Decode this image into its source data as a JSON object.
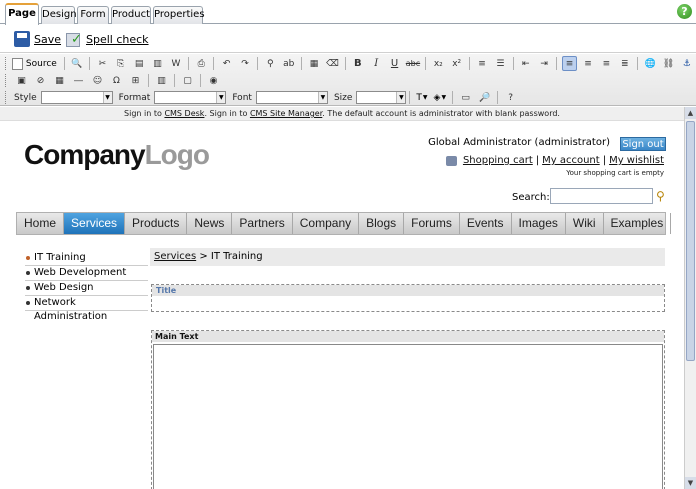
{
  "tabs": [
    "Page",
    "Design",
    "Form",
    "Product",
    "Properties"
  ],
  "actions": {
    "save": "Save",
    "spell_check": "Spell check"
  },
  "toolbar": {
    "source": "Source",
    "style_label": "Style",
    "format_label": "Format",
    "font_label": "Font",
    "size_label": "Size"
  },
  "signin_strip": {
    "prefix": "Sign in to ",
    "desk": "CMS Desk",
    "mid": ". Sign in to ",
    "manager": "CMS Site Manager",
    "suffix": ". The default account is administrator with blank password."
  },
  "header": {
    "logo_main": "Company",
    "logo_accent": "Logo",
    "user": "Global Administrator (administrator)",
    "sign_out": "Sign out",
    "shopping_cart": "Shopping cart",
    "my_account": "My account",
    "my_wishlist": "My wishlist",
    "cart_note": "Your shopping cart is empty",
    "search_label": "Search:"
  },
  "menu": [
    "Home",
    "Services",
    "Products",
    "News",
    "Partners",
    "Company",
    "Blogs",
    "Forums",
    "Events",
    "Images",
    "Wiki",
    "Examples"
  ],
  "menu_active": "Services",
  "leftnav": [
    "IT Training",
    "Web Development",
    "Web Design",
    "Network Administration"
  ],
  "breadcrumb": {
    "parent": "Services",
    "sep": " > ",
    "current": "IT Training"
  },
  "zones": {
    "title": "Title",
    "main_text": "Main Text"
  }
}
